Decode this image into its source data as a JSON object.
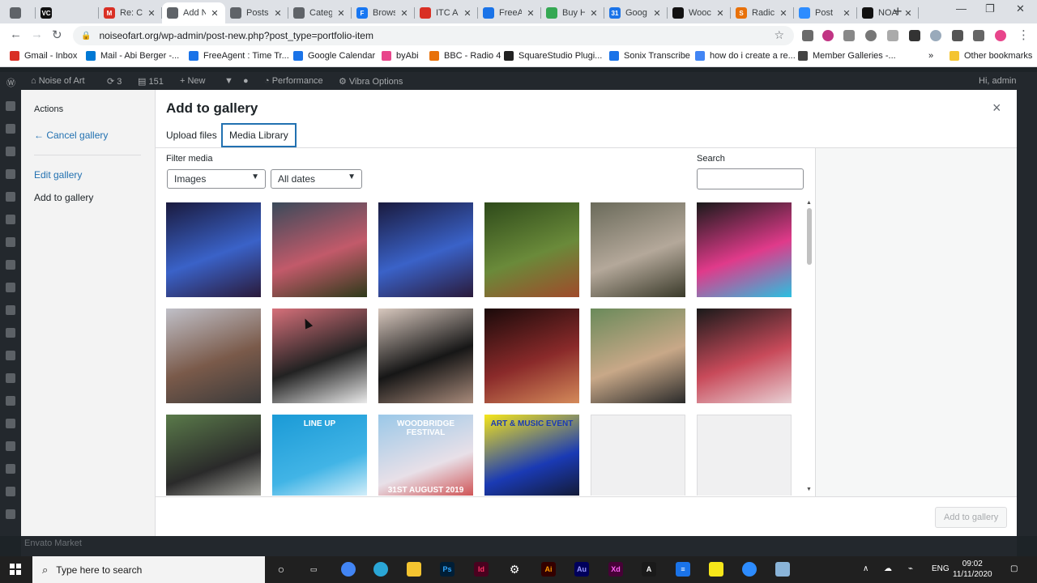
{
  "browser": {
    "tabs": [
      {
        "title": "",
        "favicon_color": "#5f6368"
      },
      {
        "title": "",
        "favicon_color": "#111111",
        "favicon_text": "VC"
      },
      {
        "title": "Re: Cr",
        "favicon_color": "#d93025",
        "favicon_text": "M"
      },
      {
        "title": "Add N",
        "favicon_color": "#5f6368",
        "active": true
      },
      {
        "title": "Posts",
        "favicon_color": "#5f6368"
      },
      {
        "title": "Categ",
        "favicon_color": "#5f6368"
      },
      {
        "title": "Brows",
        "favicon_color": "#1877f2",
        "favicon_text": "F"
      },
      {
        "title": "ITC A",
        "favicon_color": "#d93025"
      },
      {
        "title": "FreeA",
        "favicon_color": "#1a73e8"
      },
      {
        "title": "Buy H",
        "favicon_color": "#34a853"
      },
      {
        "title": "Goog",
        "favicon_color": "#1a73e8",
        "favicon_text": "31"
      },
      {
        "title": "Wooc",
        "favicon_color": "#111111"
      },
      {
        "title": "Radic",
        "favicon_color": "#e8710a",
        "favicon_text": "S"
      },
      {
        "title": "Post",
        "favicon_color": "#2d8cff"
      },
      {
        "title": "NOA",
        "favicon_color": "#111111"
      }
    ],
    "new_tab": "+",
    "url": "noiseofart.org/wp-admin/post-new.php?post_type=portfolio-item",
    "bookmarks": [
      {
        "label": "Gmail - Inbox",
        "color": "#d93025"
      },
      {
        "label": "Mail - Abi Berger -...",
        "color": "#0078d4"
      },
      {
        "label": "FreeAgent : Time Tr...",
        "color": "#1a73e8"
      },
      {
        "label": "Google Calendar",
        "color": "#1a73e8"
      },
      {
        "label": "byAbi",
        "color": "#e8458b"
      },
      {
        "label": "BBC - Radio 4",
        "color": "#e8710a"
      },
      {
        "label": "SquareStudio Plugi...",
        "color": "#222222"
      },
      {
        "label": "Sonix Transcribe",
        "color": "#1a73e8"
      },
      {
        "label": "how do i create a re...",
        "color": "#4285f4"
      },
      {
        "label": "Member Galleries -...",
        "color": "#444444"
      }
    ],
    "bookmarks_more": "»",
    "other_bookmarks": "Other bookmarks"
  },
  "adminbar": {
    "site_name": "Noise of Art",
    "updates": "3",
    "comments": "151",
    "new": "New",
    "performance": "Performance",
    "vibra": "Vibra Options",
    "greeting": "Hi, admin"
  },
  "modal": {
    "actions_heading": "Actions",
    "cancel_gallery": "← Cancel gallery",
    "edit_gallery": "Edit gallery",
    "add_to_gallery_menu": "Add to gallery",
    "title": "Add to gallery",
    "close": "×",
    "tabs": [
      "Upload files",
      "Media Library"
    ],
    "filter_label": "Filter media",
    "filter_type": "Images",
    "filter_date": "All dates",
    "search_label": "Search",
    "search_value": "",
    "footer_button": "Add to gallery"
  },
  "media": [
    {
      "name": "crowd-stage-blue-1",
      "colors": [
        "#1a1a3e",
        "#3a62c8",
        "#2a1a3a"
      ]
    },
    {
      "name": "dragon-puppet",
      "colors": [
        "#3a4a5a",
        "#c25a6a",
        "#2e3a1a"
      ]
    },
    {
      "name": "crowd-stage-blue-2",
      "colors": [
        "#1a1a3e",
        "#3a62c8",
        "#2a1a3a"
      ]
    },
    {
      "name": "green-costume-dancers",
      "colors": [
        "#2e4a1a",
        "#6a8a3a",
        "#a04a2a"
      ]
    },
    {
      "name": "skull-masks",
      "colors": [
        "#6a6a5a",
        "#b4a89a",
        "#3a3a2a"
      ]
    },
    {
      "name": "colorful-performer",
      "colors": [
        "#1a1a1a",
        "#e03a8a",
        "#2ac0e0"
      ]
    },
    {
      "name": "station-man",
      "colors": [
        "#c0c0c8",
        "#7a5a4a",
        "#3a3a3a"
      ]
    },
    {
      "name": "man-red-curtain",
      "colors": [
        "#d6707a",
        "#222222",
        "#eaeaea"
      ]
    },
    {
      "name": "two-men-portrait",
      "colors": [
        "#d8c8be",
        "#161616",
        "#a88a7a"
      ]
    },
    {
      "name": "guitar-singer",
      "colors": [
        "#1a0a0a",
        "#8a2a2a",
        "#d48a5a"
      ]
    },
    {
      "name": "selfie-couple",
      "colors": [
        "#6a8a5a",
        "#c8a888",
        "#2a2a2a"
      ]
    },
    {
      "name": "red-projection",
      "colors": [
        "#1a1a1a",
        "#c84a5a",
        "#e8d0d4"
      ]
    },
    {
      "name": "dj-park",
      "colors": [
        "#5a7a4a",
        "#2a2a2a",
        "#c8c8c0"
      ]
    },
    {
      "name": "line-up-poster",
      "colors": [
        "#1a9ad6",
        "#41b4e6",
        "#ffffff"
      ]
    },
    {
      "name": "festival-poster",
      "colors": [
        "#9ac8e8",
        "#e8e0e8",
        "#c82a2a"
      ]
    },
    {
      "name": "art-music-event-poster",
      "colors": [
        "#f6e61a",
        "#1a3ab4",
        "#111111"
      ]
    },
    {
      "name": "loading-1",
      "colors": [
        "#f0f0f1",
        "#f0f0f1",
        "#f0f0f1"
      ]
    },
    {
      "name": "loading-2",
      "colors": [
        "#f0f0f1",
        "#f0f0f1",
        "#f0f0f1"
      ]
    }
  ],
  "poster_texts": {
    "line_up": "LINE UP",
    "festival": "WOODBRIDGE FESTIVAL",
    "festival_date": "31ST AUGUST 2019",
    "art_music": "ART & MUSIC EVENT"
  },
  "taskbar": {
    "search_placeholder": "Type here to search",
    "lang": "ENG",
    "time": "09:02",
    "date": "11/11/2020",
    "bottom_strip": "Envato Market"
  }
}
